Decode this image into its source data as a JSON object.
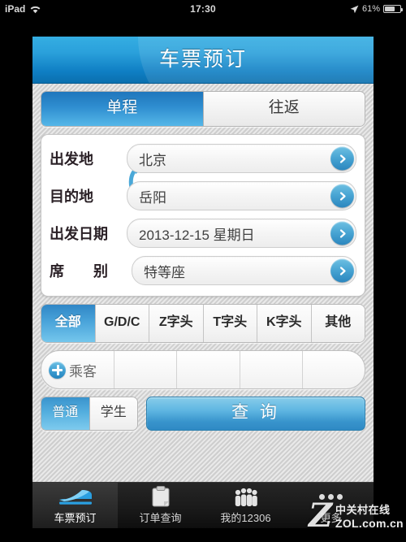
{
  "statusbar": {
    "carrier": "iPad",
    "wifi_icon": "wifi-icon",
    "time": "17:30",
    "location_icon": "location-arrow-icon",
    "battery_percent": "61%",
    "battery_level": 61
  },
  "header": {
    "title": "车票预订"
  },
  "trip_tabs": [
    {
      "label": "单程",
      "active": true
    },
    {
      "label": "往返",
      "active": false
    }
  ],
  "form": {
    "rows": [
      {
        "label": "出发地",
        "value": "北京",
        "spread": false,
        "go_icon": "chevron-right-icon"
      },
      {
        "label": "目的地",
        "value": "岳阳",
        "spread": false,
        "go_icon": "chevron-right-icon"
      },
      {
        "label": "出发日期",
        "value": "2013-12-15 星期日",
        "spread": false,
        "go_icon": "chevron-right-icon"
      },
      {
        "label": "席　　别",
        "value": "特等座",
        "spread": true,
        "go_icon": "chevron-right-icon"
      }
    ],
    "swap_icon": "swap-stations-icon"
  },
  "train_types": [
    {
      "label": "全部",
      "active": true
    },
    {
      "label": "G/D/C",
      "active": false
    },
    {
      "label": "Z字头",
      "active": false
    },
    {
      "label": "T字头",
      "active": false
    },
    {
      "label": "K字头",
      "active": false
    },
    {
      "label": "其他",
      "active": false
    }
  ],
  "passengers": {
    "add_icon": "plus-circle-icon",
    "add_label": "乘客",
    "slot_count": 4,
    "slots": [
      "",
      "",
      "",
      ""
    ]
  },
  "passenger_type": [
    {
      "label": "普通",
      "active": true
    },
    {
      "label": "学生",
      "active": false
    }
  ],
  "search_button": {
    "label": "查 询"
  },
  "tabbar": [
    {
      "label": "车票预订",
      "icon": "train-icon",
      "active": true
    },
    {
      "label": "订单查询",
      "icon": "clipboard-icon",
      "active": false
    },
    {
      "label": "我的12306",
      "icon": "people-icon",
      "active": false
    },
    {
      "label": "更多",
      "icon": "more-dots-icon",
      "active": false
    }
  ],
  "watermark": {
    "mark": "Z",
    "cn": "中关村在线",
    "en": "ZOL.com.cn"
  },
  "colors": {
    "accent_blue": "#2a8fcd",
    "header_top": "#35aee2",
    "header_bottom": "#0a6fae",
    "selected_tab": "#2f8ed0",
    "label_text": "#2a2026",
    "field_bg": "#f4f4f4",
    "card_bg": "#ffffff",
    "tabbar_bg": "#1a1a1a"
  }
}
